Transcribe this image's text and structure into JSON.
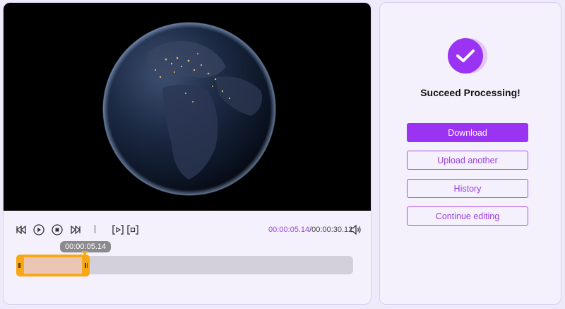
{
  "player": {
    "current_time": "00:00:05.14",
    "total_time": "/00:00:30.12",
    "tooltip_time": "00:00:05.14",
    "controls": [
      "rewind-icon",
      "play-icon",
      "stop-icon",
      "fast-forward-icon",
      "mark-in-icon",
      "mark-out-icon",
      "volume-icon"
    ],
    "accent_color": "#9b3fe0",
    "handle_color": "#f7a816"
  },
  "result": {
    "title": "Succeed Processing!",
    "icon": "check-circle-icon",
    "buttons": {
      "download": "Download",
      "upload_another": "Upload another",
      "history": "History",
      "continue_editing": "Continue editing"
    },
    "primary_color": "#9b33f2"
  }
}
